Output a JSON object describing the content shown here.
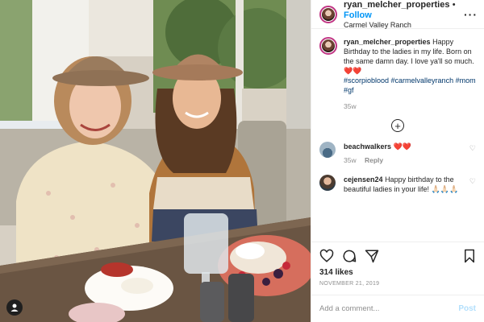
{
  "header": {
    "username": "ryan_melcher_properties",
    "separator": "•",
    "follow_label": "Follow",
    "location": "Carmel Valley Ranch",
    "more_icon": "more-horizontal-icon"
  },
  "caption": {
    "username": "ryan_melcher_properties",
    "text": "Happy Birthday to the ladies in my life. Born on the same damn day. I love ya'll so much.",
    "emoji": "❤️❤️",
    "hashtags": "#scorpioblood #carmelvalleyranch #mom #gf",
    "age": "35w"
  },
  "comments": [
    {
      "username": "beachwalkers",
      "text": "❤️❤️",
      "age": "35w",
      "reply_label": "Reply"
    },
    {
      "username": "cejensen24",
      "text": "Happy birthday to the beautiful ladies in your life! 🙏🏻🙏🏻🙏🏻"
    }
  ],
  "actions": {
    "likes": "314 likes",
    "date": "NOVEMBER 21, 2019",
    "comment_placeholder": "Add a comment...",
    "post_label": "Post"
  },
  "colors": {
    "accent": "#0095f6",
    "post_disabled": "#b2dffc",
    "text": "#262626",
    "muted": "#8e8e8e"
  }
}
